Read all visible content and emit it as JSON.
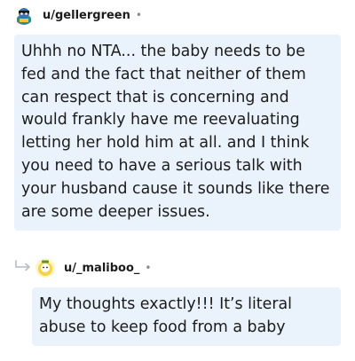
{
  "comment": {
    "username": "u/gellergreen",
    "separator": "•",
    "body": "Uhhh no NTA... the baby needs to be fed and the fact that neither of them can respect that is concerning and would frankly have me reevaluating letting her hold him at all. and I think you need to have a serious talk with your husband cause it sounds like there are some deeper issues."
  },
  "reply": {
    "username": "u/_maliboo_",
    "separator": "•",
    "body": "My thoughts exactly!!! It’s literal abuse to keep food from a baby"
  },
  "colors": {
    "bubble_background": "#eaf2fb",
    "text": "#1c1c1c",
    "muted": "#878a8c"
  },
  "icons": [
    "avatar-gellergreen",
    "reply-arrow-icon",
    "avatar-maliboo"
  ]
}
